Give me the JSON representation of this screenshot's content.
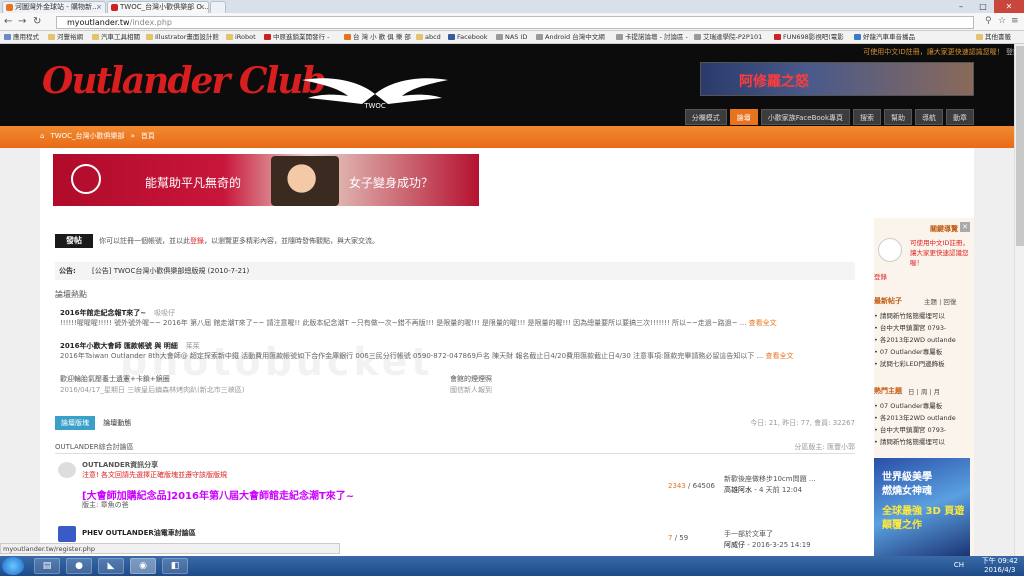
{
  "browser": {
    "tabs": [
      {
        "title": "河圖灣外金球站 - 購物新…",
        "active": false
      },
      {
        "title": "TWOC_台灣小歡俱樂部 O…",
        "active": true
      },
      {
        "title": "",
        "active": false
      }
    ],
    "url_domain": "myoutlander.tw",
    "url_path": "/index.php",
    "window_controls": [
      "–",
      "□",
      "✕"
    ],
    "bookmarks": [
      "應用程式",
      "河豐裕網",
      "汽車工具相關",
      "Illustrator畫面設計館",
      "iRobot",
      "中原進銷業開發行 - ",
      "台 灣 小 歡 俱 樂 部",
      "abcd",
      "Facebook",
      "NAS ID",
      "Android 台灣中文網",
      "卡提諾論壇 - 討論區 -",
      "艾瑞達學院-P2P101",
      "FUN698影視吧(電影",
      "好龍汽車車音播品",
      "其他書籤"
    ]
  },
  "site": {
    "logo_text": "Outlander Club",
    "logo_badge": "TWOC",
    "top_notice": "可使用中文ID註冊，讓大家更快速認識您喔！",
    "top_login": "登錄",
    "ad_title": "阿修羅之怒",
    "nav_tabs": [
      "分欄模式",
      "論壇",
      "小歡家族FaceBook專頁",
      "搜索",
      "幫助",
      "導航",
      "動章"
    ],
    "active_nav": "論壇",
    "breadcrumb": [
      "TWOC_台灣小歡俱樂部",
      "»",
      "首頁"
    ]
  },
  "main": {
    "banner_text_1": "能幫助平凡無奇的",
    "banner_text_2": "女子變身成功？",
    "post_button": "發帖",
    "post_tip_pre": "你可以註冊一個帳號，並以此",
    "post_tip_link": "登錄",
    "post_tip_post": "，以瀏覽更多精彩內容，並隨時發佈觀點，與大家交流。",
    "announce_label": "公告:",
    "announce_text": "[公告] TWOC台灣小歡俱樂部總版規  (2010-7-21)",
    "hot_title": "論壇熱點",
    "hot_items": [
      {
        "title": "2016年館走紀念報T來了~",
        "author": "吸吸仔",
        "body": "!!!!!!喔喔喔!!!!! 號外號外喔~~ 2016年 第八屆 館走潮T來了~~ 請注意喔!! 此版本紀念潮T ~只有做一次~錯不再版!!! 是限量的喔!!! 是限量的喔!!! 是限量的喔!!! 因為總量要所以要搞三次!!!!!!! 所以~~走過~路過~ ...",
        "more": "查看全文"
      },
      {
        "title": "2016年小歡大會師 匯款帳號 與 明細",
        "author": "茱茱",
        "body": "2016年Taiwan Outlander 8th大會師@ 超定探索新中鐵 活動費用匯款帳號如下合作金庫銀行 006三民分行帳號 0590-872-047869戶名 陳天財 報名截止日4/20費用匯款截止日4/30 注意事項:匯款完畢請務必留這告知以下 ...",
        "more": "查看全文"
      }
    ],
    "small_links": [
      {
        "text": "歡迎輪胎氣壓養士遺憲+卡鎖+鏡圈",
        "sub": "2016/04/17_星期日 三峽皇后鎮森林烤肉趴(新北市三峽區)"
      },
      {
        "text": "會館的煙煙照",
        "sub": "國信新人報到"
      }
    ],
    "tab_active": "論壇版塊",
    "tab_other": "論壇動態",
    "stats": "今日: 21, 昨日: 77, 會員: 32267",
    "forum_group": "OUTLANDER綜合討論區",
    "forum_group_right": "分區版主: 匯豐小郭",
    "forums": [
      {
        "name": "OUTLANDER資訊分享",
        "note": "注意! 各文回請先選擇正確版塊並遵守該版版規",
        "sticky": "[大會師加購紀念品]2016年第八屆大會師館走紀念潮T來了~",
        "moderator": "版主: 章魚の爸",
        "threads": "2343",
        "posts": "64506",
        "last_title": "新歡後座做移步10cm問題 …",
        "last_user": "高雄阿水",
        "last_time": "4 天前 12:04"
      },
      {
        "name": "PHEV OUTLANDER油電車討論區",
        "note": "",
        "sticky": "",
        "moderator": "",
        "threads": "7",
        "posts": "59",
        "last_title": "手一部於文車了",
        "last_user": "阿威仔",
        "last_time": "2016-3-25 14:19"
      }
    ]
  },
  "sidebar": {
    "header": "關鍵導覽",
    "reg_link": "可使用中文ID註冊，讓大家更快速認識您喔！",
    "login_link": "登錄",
    "new_posts_title": "最新帖子",
    "new_posts_tabs": [
      "主題",
      "回復"
    ],
    "new_posts": [
      "請問新竹銘簡擺埋可以",
      "台中大甲鎮瀾宮 0793-",
      "各2013年2WD outlande",
      "07 Outlander專屬板",
      "試問七彩LED門邊飾板"
    ],
    "hot_title": "熱門主題",
    "hot_tabs": [
      "日",
      "周",
      "月"
    ],
    "hot_posts": [
      "07 Outlander專屬板",
      "各2013年2WD outlande",
      "台中大甲鎮瀾宮 0793-",
      "請問新竹銘簡擺埋可以"
    ],
    "ad_lines": [
      "世界級美學",
      "燃燒女神魂",
      "全球最強 3D 頁遊",
      "顛覆之作"
    ]
  },
  "status": {
    "hover_url": "myoutlander.tw/register.php"
  },
  "taskbar": {
    "time": "下午 09:42",
    "date": "2016/4/3",
    "tray": "CH"
  }
}
